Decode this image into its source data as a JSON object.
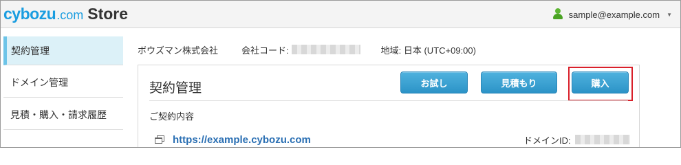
{
  "header": {
    "logo_brand": "cybozu",
    "logo_dotcom": ".com",
    "logo_store": "Store",
    "user_email": "sample@example.com",
    "user_caret": "▼"
  },
  "sidebar": {
    "items": [
      {
        "label": "契約管理",
        "active": true
      },
      {
        "label": "ドメイン管理",
        "active": false
      },
      {
        "label": "見積・購入・請求履歴",
        "active": false
      }
    ]
  },
  "info": {
    "company": "ボウズマン株式会社",
    "code_label": "会社コード:",
    "region": "地域: 日本 (UTC+09:00)"
  },
  "panel": {
    "title": "契約管理",
    "buttons": {
      "trial": "お試し",
      "quote": "見積もり",
      "buy": "購入"
    },
    "section_label": "ご契約内容",
    "domain_url": "https://example.cybozu.com",
    "domain_id_label": "ドメインID:"
  },
  "colors": {
    "accent": "#1a9de0",
    "button": "#3aa3d4",
    "highlight": "#d9202a",
    "active_nav": "#dcf1f8"
  }
}
